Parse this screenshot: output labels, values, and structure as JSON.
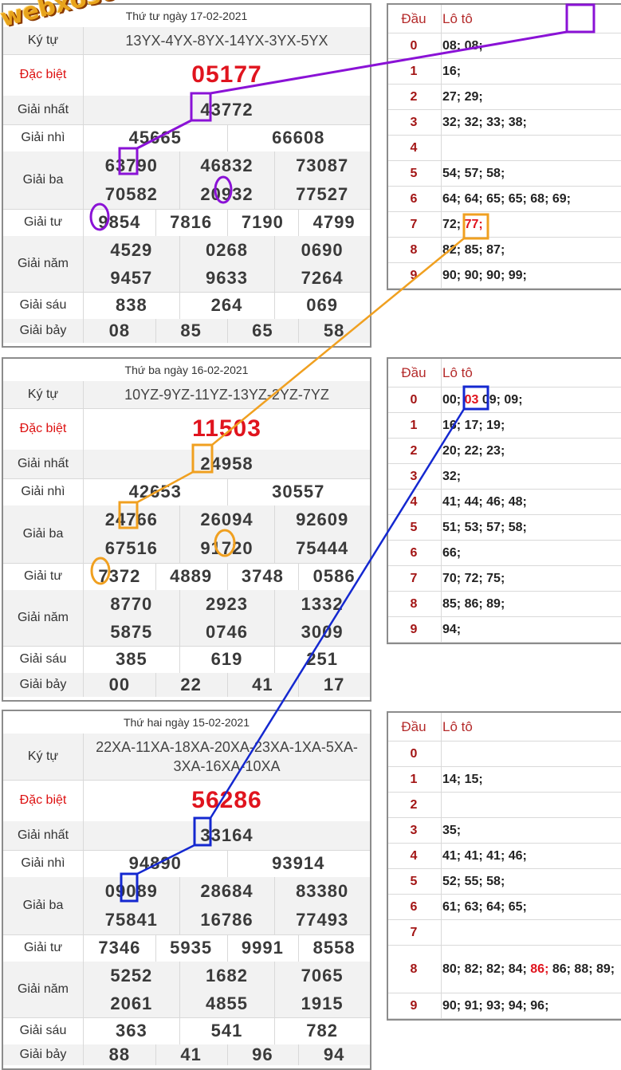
{
  "watermark": "webxoso.net",
  "labels": {
    "ky_tu": "Ký tự",
    "dac_biet": "Đặc biệt",
    "giai_nhat": "Giải nhất",
    "giai_nhi": "Giải nhì",
    "giai_ba": "Giải ba",
    "giai_tu": "Giải tư",
    "giai_nam": "Giải năm",
    "giai_sau": "Giải sáu",
    "giai_bay": "Giải bảy",
    "dau": "Đầu",
    "loto": "Lô tô"
  },
  "draws": [
    {
      "date": "Thứ tư ngày 17-02-2021",
      "ky_tu": "13YX-4YX-8YX-14YX-3YX-5YX",
      "dac_biet": "05177",
      "giai_nhat": "43772",
      "giai_nhi": [
        "45665",
        "66608"
      ],
      "giai_ba": [
        "63790",
        "46832",
        "73087",
        "70582",
        "20932",
        "77527"
      ],
      "giai_tu": [
        "9854",
        "7816",
        "7190",
        "4799"
      ],
      "giai_nam": [
        "4529",
        "0268",
        "0690",
        "9457",
        "9633",
        "7264"
      ],
      "giai_sau": [
        "838",
        "264",
        "069"
      ],
      "giai_bay": [
        "08",
        "85",
        "65",
        "58"
      ],
      "loto": [
        {
          "dau": "0",
          "val": "08; 08;"
        },
        {
          "dau": "1",
          "val": "16;"
        },
        {
          "dau": "2",
          "val": "27; 29;"
        },
        {
          "dau": "3",
          "val": "32; 32; 33; 38;"
        },
        {
          "dau": "4",
          "val": ""
        },
        {
          "dau": "5",
          "val": "54; 57; 58;"
        },
        {
          "dau": "6",
          "val": "64; 64; 65; 65; 68; 69;"
        },
        {
          "dau": "7",
          "pre": "72; ",
          "hl": "77;",
          "post": ""
        },
        {
          "dau": "8",
          "val": "82; 85; 87;"
        },
        {
          "dau": "9",
          "val": "90; 90; 90; 99;"
        }
      ]
    },
    {
      "date": "Thứ ba ngày 16-02-2021",
      "ky_tu": "10YZ-9YZ-11YZ-13YZ-2YZ-7YZ",
      "dac_biet": "11503",
      "giai_nhat": "24958",
      "giai_nhi": [
        "42653",
        "30557"
      ],
      "giai_ba": [
        "24766",
        "26094",
        "92609",
        "67516",
        "91720",
        "75444"
      ],
      "giai_tu": [
        "7372",
        "4889",
        "3748",
        "0586"
      ],
      "giai_nam": [
        "8770",
        "2923",
        "1332",
        "5875",
        "0746",
        "3009"
      ],
      "giai_sau": [
        "385",
        "619",
        "251"
      ],
      "giai_bay": [
        "00",
        "22",
        "41",
        "17"
      ],
      "loto": [
        {
          "dau": "0",
          "pre": "00; ",
          "hl": "03",
          "post": " 09; 09;"
        },
        {
          "dau": "1",
          "val": "16; 17; 19;"
        },
        {
          "dau": "2",
          "val": "20; 22; 23;"
        },
        {
          "dau": "3",
          "val": "32;"
        },
        {
          "dau": "4",
          "val": "41; 44; 46; 48;"
        },
        {
          "dau": "5",
          "val": "51; 53; 57; 58;"
        },
        {
          "dau": "6",
          "val": "66;"
        },
        {
          "dau": "7",
          "val": "70; 72; 75;"
        },
        {
          "dau": "8",
          "val": "85; 86; 89;"
        },
        {
          "dau": "9",
          "val": "94;"
        }
      ]
    },
    {
      "date": "Thứ hai ngày 15-02-2021",
      "ky_tu": "22XA-11XA-18XA-20XA-23XA-1XA-5XA-3XA-16XA-10XA",
      "dac_biet": "56286",
      "giai_nhat": "33164",
      "giai_nhi": [
        "94890",
        "93914"
      ],
      "giai_ba": [
        "09089",
        "28684",
        "83380",
        "75841",
        "16786",
        "77493"
      ],
      "giai_tu": [
        "7346",
        "5935",
        "9991",
        "8558"
      ],
      "giai_nam": [
        "5252",
        "1682",
        "7065",
        "2061",
        "4855",
        "1915"
      ],
      "giai_sau": [
        "363",
        "541",
        "782"
      ],
      "giai_bay": [
        "88",
        "41",
        "96",
        "94"
      ],
      "loto": [
        {
          "dau": "0",
          "val": ""
        },
        {
          "dau": "1",
          "val": "14; 15;"
        },
        {
          "dau": "2",
          "val": ""
        },
        {
          "dau": "3",
          "val": "35;"
        },
        {
          "dau": "4",
          "val": "41; 41; 41; 46;"
        },
        {
          "dau": "5",
          "val": "52; 55; 58;"
        },
        {
          "dau": "6",
          "val": "61; 63; 64; 65;"
        },
        {
          "dau": "7",
          "val": ""
        },
        {
          "dau": "8",
          "pre": "80; 82; 82; 84; ",
          "hl": "86;",
          "post": " 86; 88; 89;"
        },
        {
          "dau": "9",
          "val": "90; 91; 93; 94; 96;"
        }
      ]
    }
  ],
  "annotation_colors": {
    "purple": "#8a12d6",
    "orange": "#f0a020",
    "blue": "#1428d0"
  }
}
